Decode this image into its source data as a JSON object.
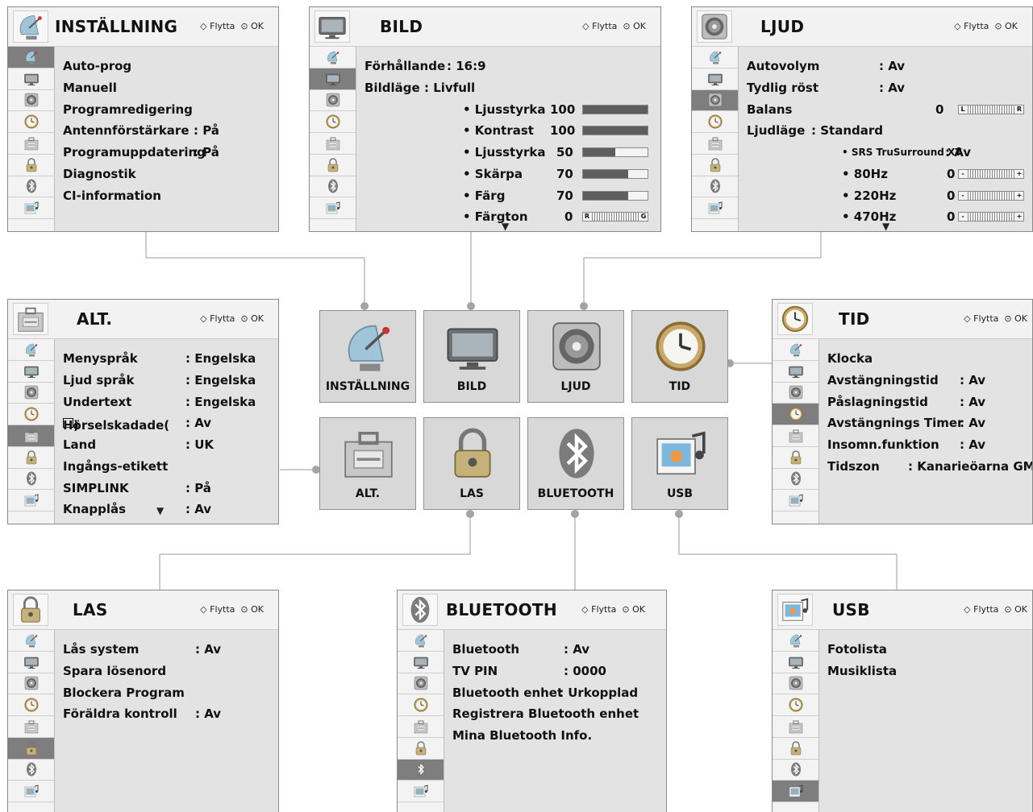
{
  "nav_hint": {
    "move": "Flytta",
    "ok": "OK"
  },
  "scroll_down": "▼",
  "menu_icons": [
    "satellite-icon",
    "monitor-icon",
    "speaker-icon",
    "clock-icon",
    "toolbox-icon",
    "lock-icon",
    "bluetooth-icon",
    "usb-photo-icon"
  ],
  "hub": {
    "tiles": [
      {
        "label": "INSTÄLLNING",
        "icon": "satellite-icon"
      },
      {
        "label": "BILD",
        "icon": "monitor-icon"
      },
      {
        "label": "LJUD",
        "icon": "speaker-icon"
      },
      {
        "label": "TID",
        "icon": "clock-icon"
      },
      {
        "label": "ALT.",
        "icon": "toolbox-icon"
      },
      {
        "label": "LAS",
        "icon": "lock-icon"
      },
      {
        "label": "BLUETOOTH",
        "icon": "bluetooth-icon"
      },
      {
        "label": "USB",
        "icon": "usb-photo-icon"
      }
    ]
  },
  "installning": {
    "title": "INSTÄLLNING",
    "rows": [
      {
        "label": "Auto-prog",
        "value": ""
      },
      {
        "label": "Manuell",
        "value": ""
      },
      {
        "label": "Programredigering",
        "value": ""
      },
      {
        "label": "Antennförstärkare",
        "value": ": På"
      },
      {
        "label": "Programuppdatering",
        "value": ": På"
      },
      {
        "label": "Diagnostik",
        "value": ""
      },
      {
        "label": "CI-information",
        "value": ""
      }
    ]
  },
  "bild": {
    "title": "BILD",
    "rows": [
      {
        "label": "Förhållande",
        "value": ": 16:9"
      },
      {
        "label": "Bildläge",
        "value": ": Livfull"
      }
    ],
    "sliders": [
      {
        "label": "• Ljusstyrka",
        "value": "100",
        "level": 1.0
      },
      {
        "label": "• Kontrast",
        "value": "100",
        "level": 1.0
      },
      {
        "label": "• Ljusstyrka",
        "value": "50",
        "level": 0.5
      },
      {
        "label": "• Skärpa",
        "value": "70",
        "level": 0.7
      },
      {
        "label": "• Färg",
        "value": "70",
        "level": 0.7
      }
    ],
    "tint": {
      "label": "• Färgton",
      "value": "0",
      "left": "R",
      "right": "G"
    }
  },
  "ljud": {
    "title": "LJUD",
    "rows": [
      {
        "label": "Autovolym",
        "value": ": Av"
      },
      {
        "label": "Tydlig röst",
        "value": ": Av"
      }
    ],
    "balance": {
      "label": "Balans",
      "value": "0",
      "left": "L",
      "right": "R"
    },
    "mode": {
      "label": "Ljudläge",
      "value": ": Standard"
    },
    "srs": {
      "label": "• SRS TruSurround XT",
      "value": ": Av"
    },
    "eq": [
      {
        "label": "• 80Hz",
        "value": "0",
        "left": "-",
        "right": "+"
      },
      {
        "label": "• 220Hz",
        "value": "0",
        "left": "-",
        "right": "+"
      },
      {
        "label": "• 470Hz",
        "value": "0",
        "left": "-",
        "right": "+"
      }
    ]
  },
  "alt": {
    "title": "ALT.",
    "rows": [
      {
        "label": "Menyspråk",
        "value": ": Engelska"
      },
      {
        "label": "Ljud språk",
        "value": ": Engelska"
      },
      {
        "label": "Undertext",
        "value": ": Engelska"
      },
      {
        "label": "Hörselskadade(",
        "value": ": Av"
      },
      {
        "label": "Land",
        "value": ": UK"
      },
      {
        "label": "Ingångs-etikett",
        "value": ""
      },
      {
        "label": "SIMPLINK",
        "value": ": På"
      },
      {
        "label": "Knapplås",
        "value": ": Av"
      }
    ],
    "hearing_suffix": ")"
  },
  "tid": {
    "title": "TID",
    "rows": [
      {
        "label": "Klocka",
        "value": ""
      },
      {
        "label": "Avstängningstid",
        "value": ": Av"
      },
      {
        "label": "Påslagningstid",
        "value": ": Av"
      },
      {
        "label": "Avstängnings Timer",
        "value": ": Av"
      },
      {
        "label": "Insomn.funktion",
        "value": ": Av"
      },
      {
        "label": "Tidszon",
        "value": ": Kanarieöarna GMT"
      }
    ]
  },
  "las": {
    "title": "LAS",
    "rows": [
      {
        "label": "Lås system",
        "value": ": Av"
      },
      {
        "label": "Spara lösenord",
        "value": ""
      },
      {
        "label": "Blockera Program",
        "value": ""
      },
      {
        "label": "Föräldra kontroll",
        "value": ": Av"
      }
    ]
  },
  "bluetooth": {
    "title": "BLUETOOTH",
    "rows": [
      {
        "label": "Bluetooth",
        "value": ": Av"
      },
      {
        "label": "TV PIN",
        "value": ": 0000"
      },
      {
        "label": "Bluetooth enhet",
        "value": ": Urkopplad"
      },
      {
        "label": "Registrera Bluetooth enhet",
        "value": ""
      },
      {
        "label": "Mina Bluetooth Info.",
        "value": ""
      }
    ]
  },
  "usb": {
    "title": "USB",
    "rows": [
      {
        "label": "Fotolista",
        "value": ""
      },
      {
        "label": "Musiklista",
        "value": ""
      }
    ]
  }
}
